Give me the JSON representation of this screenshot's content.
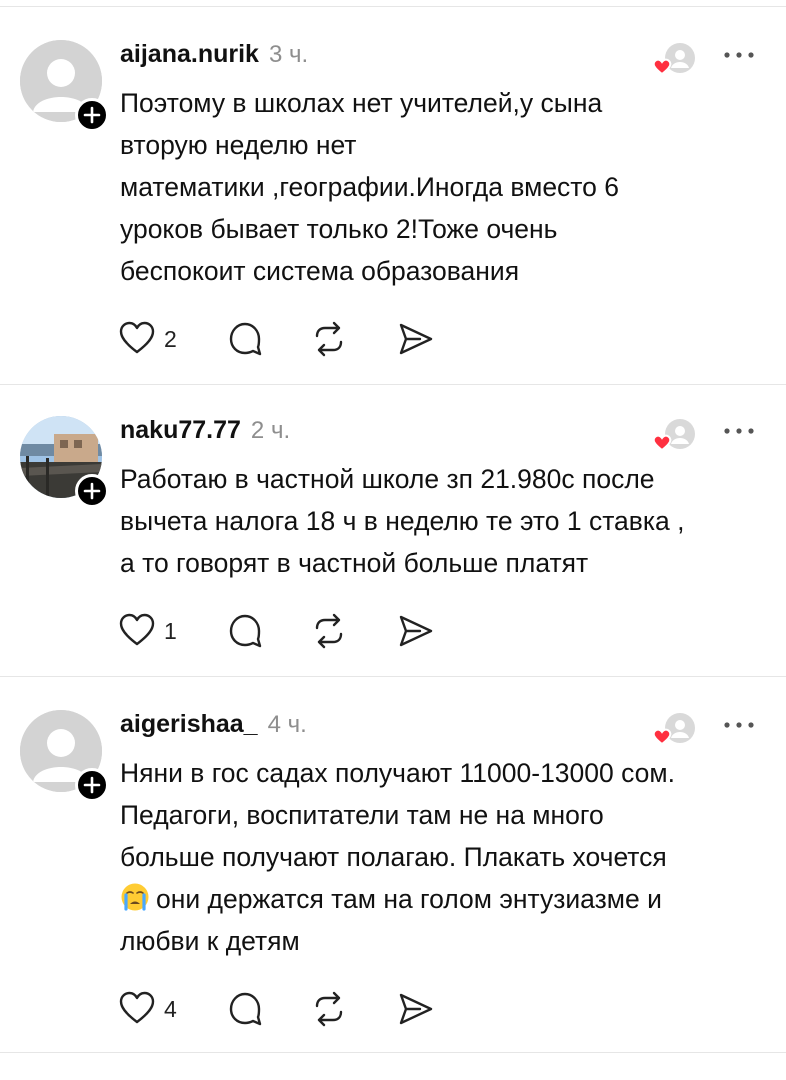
{
  "posts": [
    {
      "username": "aijana.nurik",
      "time": "3 ч.",
      "lines": [
        "Поэтому в школах нет учителей,у сына",
        "вторую неделю нет",
        "математики ,географии.Иногда вместо 6",
        "уроков бывает только 2!Тоже очень",
        "беспокоит система образования"
      ],
      "like_count": "2",
      "avatar": "default-avatar"
    },
    {
      "username": "naku77.77",
      "time": "2 ч.",
      "lines": [
        "Работаю в частной школе зп 21.980с после",
        "вычета налога 18 ч в неделю те это 1 ставка ,",
        "а то говорят в частной больше платят"
      ],
      "like_count": "1",
      "avatar": "photo-avatar"
    },
    {
      "username": "aigerishaa_",
      "time": "4 ч.",
      "lines": [
        "Няни в гос садах получают 11000-13000 сом.",
        "Педагоги, воспитатели там не на много",
        "больше получают полагаю. Плакать хочется",
        "они держатся там на голом энтузиазме и",
        "любви к детям"
      ],
      "emoji_before_line": 3,
      "emoji": "crying-face-emoji",
      "like_count": "4",
      "avatar": "default-avatar"
    }
  ],
  "icons": {
    "like": "heart-outline-icon",
    "comment": "comment-bubble-icon",
    "repost": "repost-icon",
    "share": "send-icon",
    "more": "more-dots-icon",
    "follow": "plus-icon",
    "liked_by_author": "liked-by-author-icon"
  },
  "colors": {
    "accent_heart": "#ff3040",
    "divider": "#e6e6e6",
    "muted_text": "#8e8e8e"
  }
}
